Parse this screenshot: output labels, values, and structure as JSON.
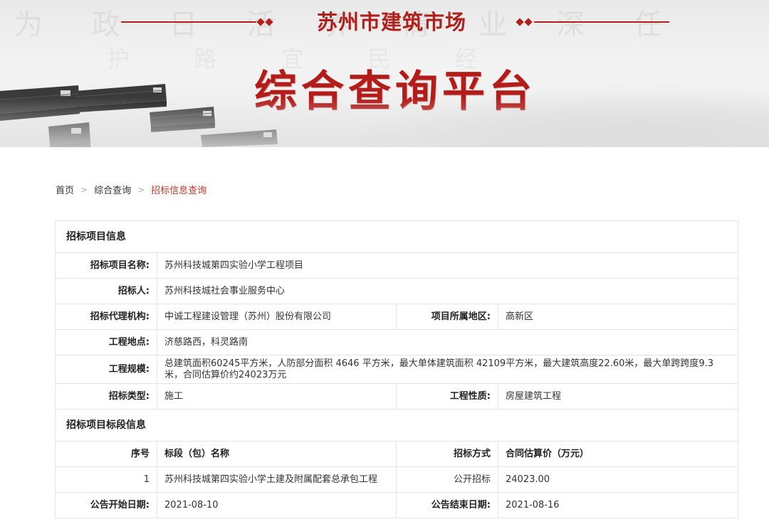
{
  "banner": {
    "city_title": "苏州市建筑市场",
    "platform_title": "综合查询平台",
    "faded_text_1": "为 政 日 活 养 情 业 深 任",
    "faded_text_2": "护 路 宜 民 经"
  },
  "breadcrumb": [
    {
      "label": "首页"
    },
    {
      "label": "综合查询"
    },
    {
      "label": "招标信息查询"
    }
  ],
  "project_info": {
    "section_title": "招标项目信息",
    "name_label": "招标项目名称:",
    "name_value": "苏州科技城第四实验小学工程项目",
    "tenderer_label": "招标人:",
    "tenderer_value": "苏州科技城社会事业服务中心",
    "agency_label": "招标代理机构:",
    "agency_value": "中诚工程建设管理（苏州）股份有限公司",
    "region_label": "项目所属地区:",
    "region_value": "高新区",
    "location_label": "工程地点:",
    "location_value": "济慈路西，科灵路南",
    "scale_label": "工程规模:",
    "scale_value": "总建筑面积60245平方米，人防部分面积 4646 平方米，最大单体建筑面积 42109平方米，最大建筑高度22.60米，最大单跨跨度9.3米，合同估算价约24023万元",
    "type_label": "招标类型:",
    "type_value": "施工",
    "nature_label": "工程性质:",
    "nature_value": "房屋建筑工程"
  },
  "lot_info": {
    "section_title": "招标项目标段信息",
    "headers": {
      "index": "序号",
      "name": "标段（包）名称",
      "method": "招标方式",
      "price": "合同估算价（万元）"
    },
    "rows": [
      {
        "index": "1",
        "name": "苏州科技城第四实验小学土建及附属配套总承包工程",
        "method": "公开招标",
        "price": "24023.00"
      }
    ],
    "start_label": "公告开始日期:",
    "start_value": "2021-08-10",
    "end_label": "公告结束日期:",
    "end_value": "2021-08-16"
  },
  "colors": {
    "brand_red": "#b0211c",
    "breadcrumb_current": "#c0392b",
    "table_border": "#e4e4e4"
  }
}
